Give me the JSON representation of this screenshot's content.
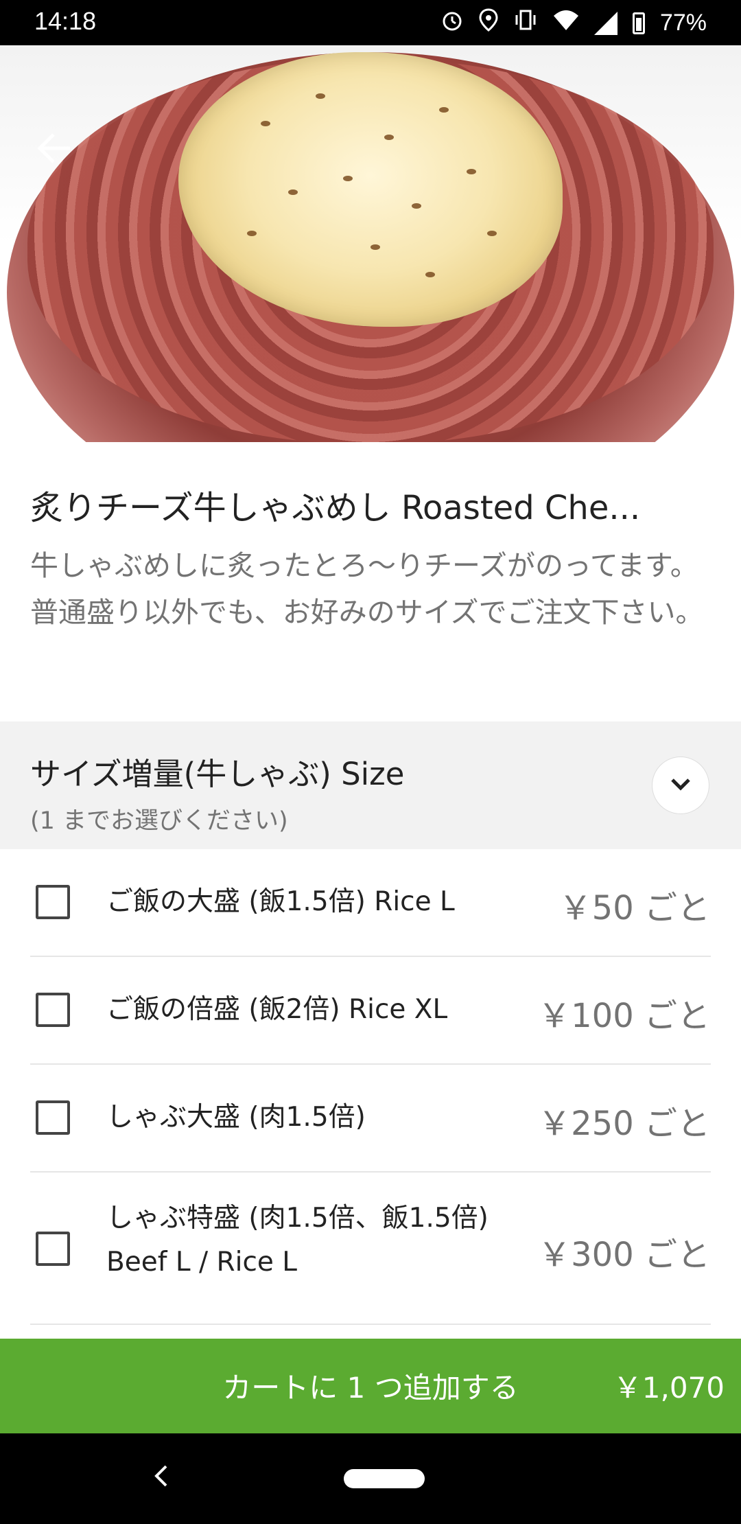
{
  "status_bar": {
    "time": "14:18",
    "battery": "77%",
    "icons": [
      "alarm-icon",
      "location-icon",
      "vibrate-icon",
      "wifi-icon",
      "signal-icon",
      "battery-icon"
    ]
  },
  "item": {
    "title": "炙りチーズ牛しゃぶめし Roasted Che...",
    "description": "牛しゃぶめしに炙ったとろ〜りチーズがのってます。普通盛り以外でも、お好みのサイズでご注文下さい。"
  },
  "section": {
    "title": "サイズ増量(牛しゃぶ) Size",
    "subtitle": "(1 までお選びください)"
  },
  "options": [
    {
      "label_line1": "ご飯の大盛 (飯1.5倍)  Rice L",
      "label_line2": "",
      "price": "￥50 ごと",
      "checked": false
    },
    {
      "label_line1": "ご飯の倍盛 (飯2倍)  Rice XL",
      "label_line2": "",
      "price": "￥100 ごと",
      "checked": false
    },
    {
      "label_line1": "しゃぶ大盛 (肉1.5倍)",
      "label_line2": "",
      "price": "￥250 ごと",
      "checked": false
    },
    {
      "label_line1": "しゃぶ特盛 (肉1.5倍、飯1.5倍)",
      "label_line2": "Beef L / Rice L",
      "price": "￥300 ごと",
      "checked": false
    }
  ],
  "cart": {
    "label": "カートに 1 つ追加する",
    "total": "￥1,070"
  },
  "colors": {
    "accent_green": "#5bab31",
    "section_bg": "#f2f2f2",
    "secondary_text": "#737373"
  }
}
